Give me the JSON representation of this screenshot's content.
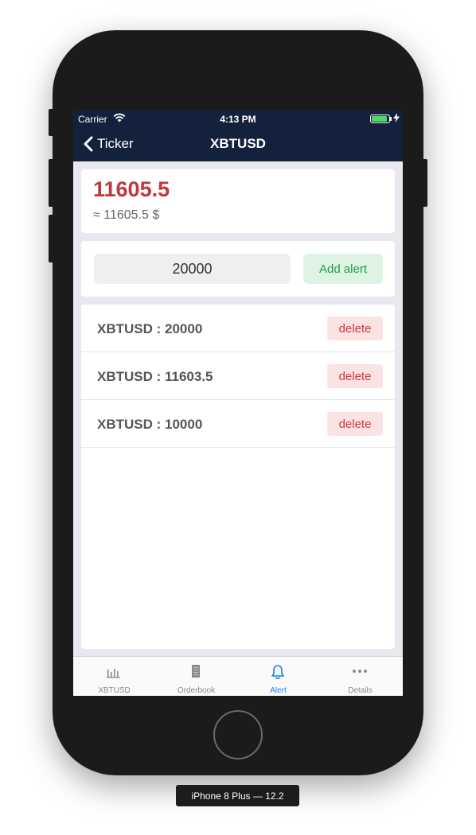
{
  "status_bar": {
    "carrier": "Carrier",
    "time": "4:13 PM"
  },
  "nav": {
    "back_label": "Ticker",
    "title": "XBTUSD"
  },
  "price": {
    "value": "11605.5",
    "approx": "≈ 11605.5 $",
    "color": "#c0363d"
  },
  "alert_form": {
    "input_value": "20000",
    "add_label": "Add alert"
  },
  "alerts": [
    {
      "label": "XBTUSD : 20000",
      "delete_label": "delete"
    },
    {
      "label": "XBTUSD : 11603.5",
      "delete_label": "delete"
    },
    {
      "label": "XBTUSD : 10000",
      "delete_label": "delete"
    }
  ],
  "tabs": [
    {
      "label": "XBTUSD",
      "icon": "bar-chart-icon",
      "active": false
    },
    {
      "label": "Orderbook",
      "icon": "book-icon",
      "active": false
    },
    {
      "label": "Alert",
      "icon": "bell-icon",
      "active": true
    },
    {
      "label": "Details",
      "icon": "more-icon",
      "active": false
    }
  ],
  "device_label": "iPhone 8 Plus — 12.2",
  "colors": {
    "header": "#14213d",
    "accent": "#1a7ff0",
    "add_green": "#1f9c45",
    "delete_red": "#c8393f"
  }
}
